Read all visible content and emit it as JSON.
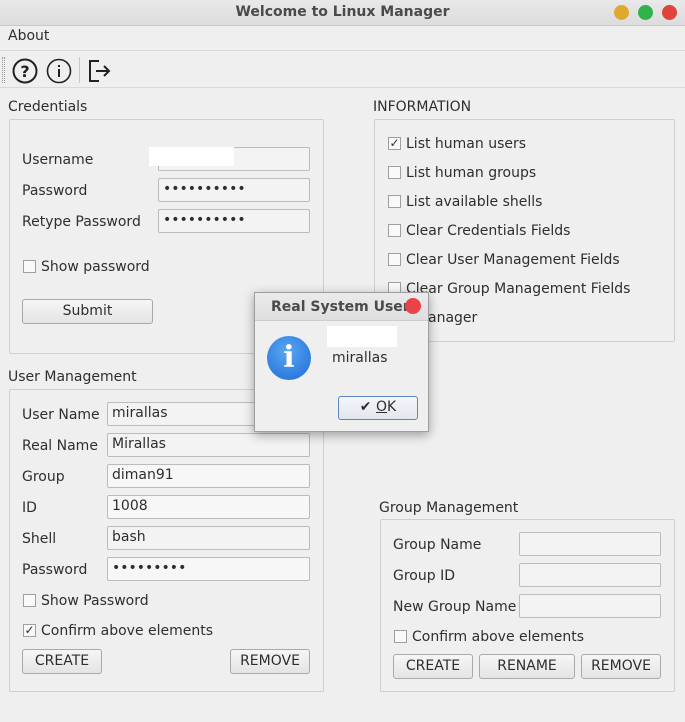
{
  "window": {
    "title": "Welcome to Linux Manager"
  },
  "menu": {
    "about": "About"
  },
  "toolbar": {
    "icons": [
      "help-icon",
      "info-icon",
      "exit-icon"
    ]
  },
  "credentials": {
    "title": "Credentials",
    "username_label": "Username",
    "username_value": "",
    "password_label": "Password",
    "password_value": "••••••••••",
    "retype_label": "Retype Password",
    "retype_value": "••••••••••",
    "show_password": "Show password",
    "submit": "Submit"
  },
  "information": {
    "title": "INFORMATION",
    "options": [
      {
        "label": "List human users",
        "checked": true
      },
      {
        "label": "List human groups",
        "checked": false
      },
      {
        "label": "List available shells",
        "checked": false
      },
      {
        "label": "Clear Credentials Fields",
        "checked": false
      },
      {
        "label": "Clear User Management Fields",
        "checked": false
      },
      {
        "label": "Clear Group Management Fields",
        "checked": false
      },
      {
        "label": "Exit Manager",
        "visible_text": "t Manager",
        "checked": false
      }
    ]
  },
  "user_management": {
    "title": "User Management",
    "user_name_label": "User Name",
    "user_name_value": "mirallas",
    "real_name_label": "Real Name",
    "real_name_value": "Mirallas",
    "group_label": "Group",
    "group_value": "diman91",
    "id_label": "ID",
    "id_value": "1008",
    "shell_label": "Shell",
    "shell_value": "bash",
    "password_label": "Password",
    "password_value": "•••••••••",
    "show_password": "Show Password",
    "confirm": "Confirm above elements",
    "create": "CREATE",
    "remove": "REMOVE"
  },
  "group_management": {
    "title": "Group Management",
    "group_name_label": "Group Name",
    "group_name_value": "",
    "group_id_label": "Group ID",
    "group_id_value": "",
    "new_group_name_label": "New Group Name",
    "new_group_name_value": "",
    "confirm": "Confirm above elements",
    "create": "CREATE",
    "rename": "RENAME",
    "remove": "REMOVE"
  },
  "dialog": {
    "title": "Real System Users",
    "message": "mirallas",
    "ok": "OK",
    "ok_mnemonic": "O",
    "ok_rest": "K",
    "ok_check": "✔"
  },
  "colors": {
    "accent": "#1d6ad8",
    "close": "#e0433a",
    "minimize": "#e0a82e",
    "maximize": "#2fb34a"
  }
}
